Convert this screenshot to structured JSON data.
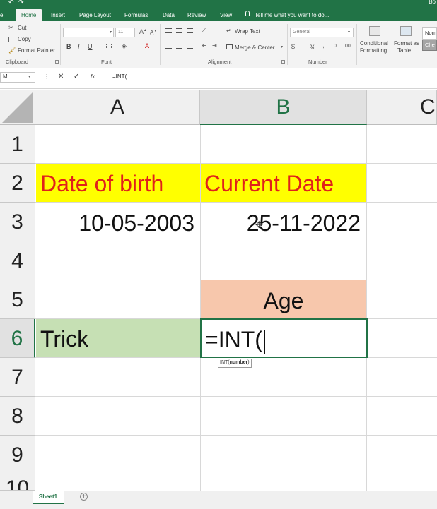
{
  "title_bar": {
    "tabs": [
      {
        "label": "e"
      },
      {
        "label": "Home"
      },
      {
        "label": "Insert"
      },
      {
        "label": "Page Layout"
      },
      {
        "label": "Formulas"
      },
      {
        "label": "Data"
      },
      {
        "label": "Review"
      },
      {
        "label": "View"
      }
    ],
    "tell_me": "Tell me what you want to do...",
    "user_fragment": "Bo"
  },
  "ribbon": {
    "clipboard": {
      "cut": "Cut",
      "copy": "Copy",
      "format_painter": "Format Painter",
      "label": "Clipboard"
    },
    "font": {
      "size": "11",
      "label": "Font"
    },
    "alignment": {
      "wrap_text": "Wrap Text",
      "merge_center": "Merge & Center",
      "label": "Alignment"
    },
    "number": {
      "format": "General",
      "percent": "%",
      "comma": ",",
      "label": "Number"
    },
    "styles": {
      "conditional": "Conditional",
      "formatting": "Formatting",
      "format_as": "Format as",
      "table": "Table",
      "normal_fragment": "Norm",
      "check_fragment": "Che"
    }
  },
  "formula_bar": {
    "name_box": "M",
    "fx": "fx",
    "content": "=INT("
  },
  "columns": [
    "A",
    "B",
    "C"
  ],
  "rows": [
    "1",
    "2",
    "3",
    "4",
    "5",
    "6",
    "7",
    "8",
    "9",
    "10"
  ],
  "cells": {
    "a2": "Date of birth",
    "b2": "Current Date",
    "a3": "10-05-2003",
    "b3": "25-11-2022",
    "b5": "Age",
    "a6": "Trick",
    "b6": "=INT("
  },
  "tooltip": {
    "func": "INT(",
    "arg": "number",
    "close": ")"
  },
  "sheets": [
    {
      "name": "Sheet1"
    }
  ],
  "colors": {
    "accent": "#217346",
    "yellow_fill": "#ffff00",
    "red_text": "#e0211b",
    "peach_fill": "#f7c7ac",
    "green_fill": "#c6e0b4"
  }
}
